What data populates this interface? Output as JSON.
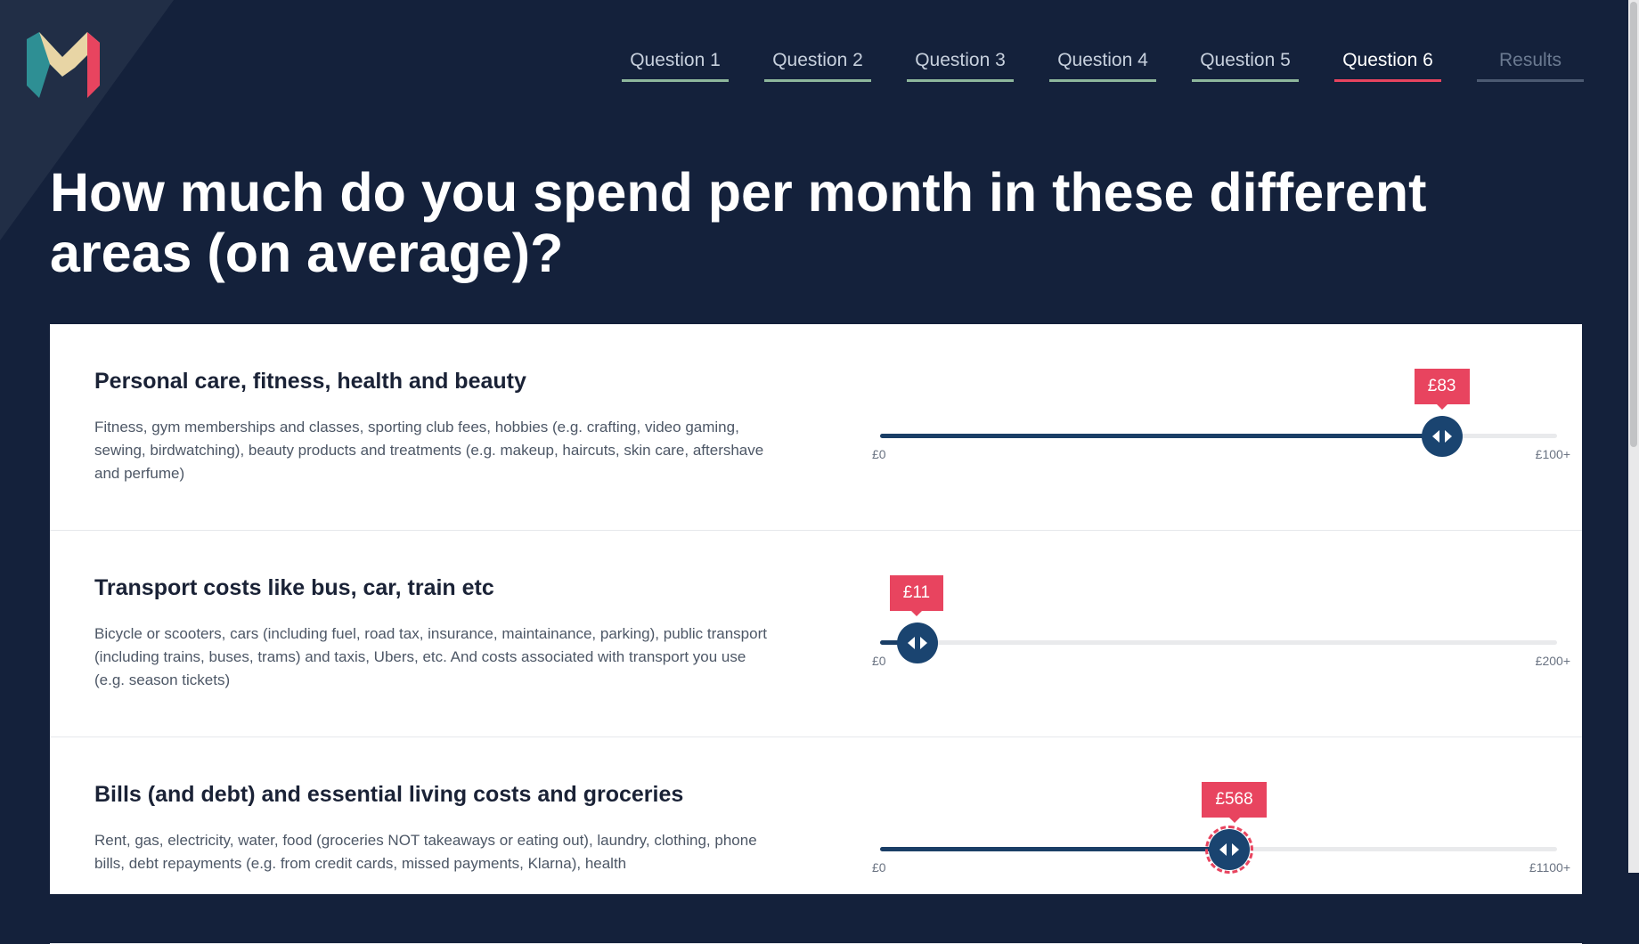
{
  "nav": {
    "items": [
      {
        "label": "Question 1",
        "state": "done"
      },
      {
        "label": "Question 2",
        "state": "done"
      },
      {
        "label": "Question 3",
        "state": "done"
      },
      {
        "label": "Question 4",
        "state": "done"
      },
      {
        "label": "Question 5",
        "state": "done"
      },
      {
        "label": "Question 6",
        "state": "active"
      },
      {
        "label": "Results",
        "state": "disabled"
      }
    ]
  },
  "page": {
    "title": "How much do you spend per month in these different areas (on average)?"
  },
  "questions": [
    {
      "title": "Personal care, fitness, health and beauty",
      "description": "Fitness, gym memberships and classes, sporting club fees, hobbies (e.g. crafting, video gaming, sewing, birdwatching), beauty products and treatments (e.g. makeup, haircuts, skin care, aftershave and perfume)",
      "slider": {
        "value_label": "£83",
        "value": 83,
        "max": 100,
        "min_label": "£0",
        "max_label": "£100+",
        "focused": false
      }
    },
    {
      "title": "Transport costs like bus, car, train etc",
      "description": "Bicycle or scooters, cars (including fuel, road tax, insurance, maintainance, parking), public transport (including trains, buses, trams) and taxis, Ubers, etc. And costs associated with transport you use (e.g. season tickets)",
      "slider": {
        "value_label": "£11",
        "value": 11,
        "max": 200,
        "min_label": "£0",
        "max_label": "£200+",
        "focused": false
      }
    },
    {
      "title": "Bills (and debt) and essential living costs and groceries",
      "description": "Rent, gas, electricity, water, food (groceries NOT takeaways or eating out), laundry, clothing, phone bills, debt repayments (e.g. from credit cards, missed payments, Klarna), health",
      "slider": {
        "value_label": "£568",
        "value": 568,
        "max": 1100,
        "min_label": "£0",
        "max_label": "£1100+",
        "focused": true
      }
    }
  ],
  "colors": {
    "background": "#14213b",
    "accent": "#e8445f",
    "slider_fill": "#1a3e66",
    "nav_done": "#8eb79c"
  },
  "icons": {
    "logo": "monzo-logo",
    "slider_thumb": "left-right-arrows-icon"
  }
}
